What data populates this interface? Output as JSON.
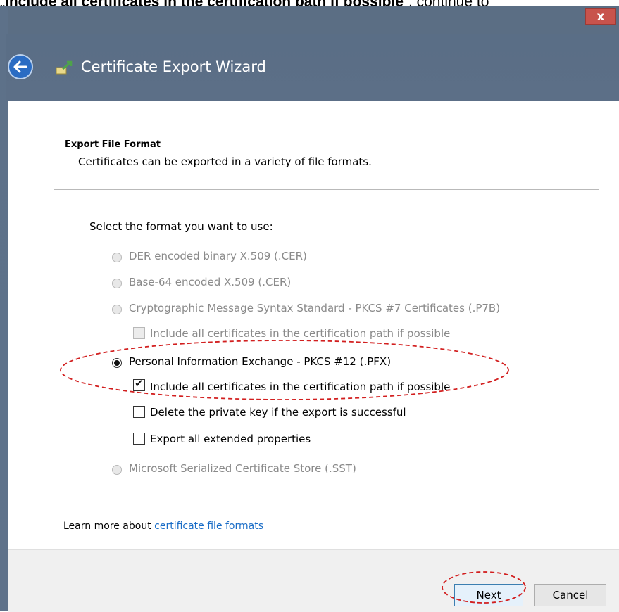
{
  "caption": {
    "prefix": "„",
    "bold": "Include all certificates in the certification path if possible",
    "suffix": "“, continue to"
  },
  "window": {
    "close_glyph": "x"
  },
  "wizard": {
    "title": "Certificate Export Wizard"
  },
  "section": {
    "title": "Export File Format",
    "description": "Certificates can be exported in a variety of file formats."
  },
  "format_prompt": "Select the format you want to use:",
  "options": {
    "der": "DER encoded binary X.509 (.CER)",
    "base64": "Base-64 encoded X.509 (.CER)",
    "pkcs7": "Cryptographic Message Syntax Standard - PKCS #7 Certificates (.P7B)",
    "pkcs7_include": "Include all certificates in the certification path if possible",
    "pfx": "Personal Information Exchange - PKCS #12 (.PFX)",
    "pfx_include": "Include all certificates in the certification path if possible",
    "pfx_delete_key": "Delete the private key if the export is successful",
    "pfx_export_props": "Export all extended properties",
    "sst": "Microsoft Serialized Certificate Store (.SST)"
  },
  "learn_more": {
    "prefix": "Learn more about ",
    "link": "certificate file formats"
  },
  "buttons": {
    "next": "Next",
    "cancel": "Cancel"
  },
  "state": {
    "selected_format": "pfx",
    "pfx_include_checked": true,
    "pfx_delete_key_checked": false,
    "pfx_export_props_checked": false
  },
  "colors": {
    "accent": "#2a6cc3",
    "annotation": "#d21f1f",
    "link": "#1a6dc7"
  },
  "icons": {
    "close": "close-icon",
    "back": "back-arrow-icon",
    "wizard": "certificate-icon"
  }
}
